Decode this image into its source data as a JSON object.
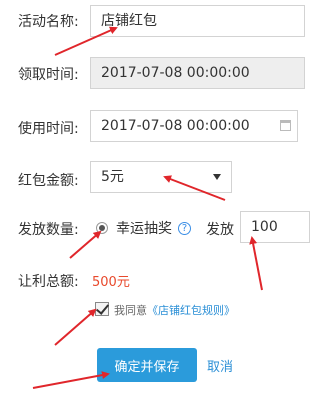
{
  "form": {
    "activity_name": {
      "label": "活动名称:",
      "value": "店铺红包"
    },
    "receive_time": {
      "label": "领取时间:",
      "value": "2017-07-08 00:00:00"
    },
    "use_time": {
      "label": "使用时间:",
      "value": "2017-07-08 00:00:00"
    },
    "amount": {
      "label": "红包金额:",
      "selected": "5元"
    },
    "issue_count": {
      "label": "发放数量:",
      "option_label": "幸运抽奖",
      "issue_label": "发放",
      "issue_value": "100"
    },
    "total_profit": {
      "label": "让利总额:",
      "value": "500元"
    },
    "agreement": {
      "prefix": "我同意",
      "link": "《店铺红包规则》",
      "checked": true
    },
    "submit_label": "确定并保存",
    "cancel_label": "取消"
  },
  "colors": {
    "accent": "#2b9bdb",
    "link": "#2b8fd6",
    "amount_red": "#e8492c",
    "annotation_red": "#e0262b"
  },
  "icons": {
    "calendar": "calendar-icon",
    "dropdown": "chevron-down-icon",
    "help": "question-circle-icon"
  }
}
